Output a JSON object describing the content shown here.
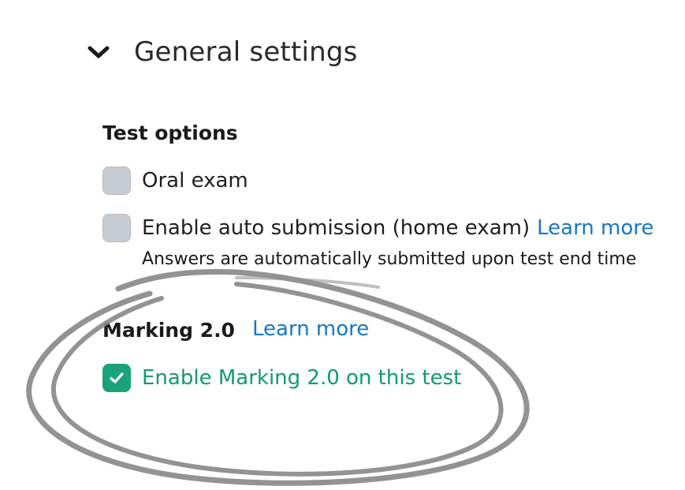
{
  "general_settings": {
    "title": "General settings",
    "expand_icon": "chevron-down-icon"
  },
  "test_options": {
    "heading": "Test options",
    "oral_exam": {
      "label": "Oral exam",
      "checked": false
    },
    "auto_submission": {
      "label": "Enable auto submission (home exam)",
      "link": "Learn more",
      "helper": "Answers are automatically submitted upon test end time",
      "checked": false
    }
  },
  "marking": {
    "heading": "Marking 2.0",
    "link": "Learn more",
    "enable": {
      "label": "Enable Marking 2.0 on this test",
      "checked": true,
      "check_icon": "checkmark-icon"
    }
  },
  "colors": {
    "checkbox_unchecked": "#c7ccd3",
    "checkbox_checked": "#1aa37a",
    "link": "#1577c6",
    "checked_label": "#129a6f",
    "annotation_stroke": "#8a8a8a"
  }
}
